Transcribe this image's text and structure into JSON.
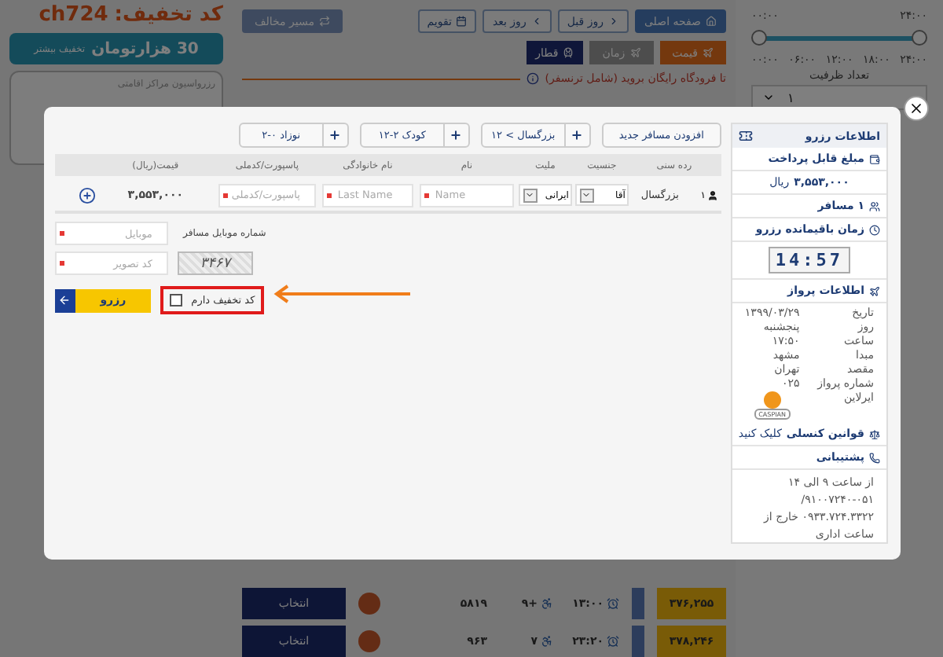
{
  "background": {
    "promo": {
      "code_label": "کد تخفیف:",
      "code": "ch724",
      "amount": "30 هزارتومان",
      "amount_note": "تخفیف بیشتر",
      "banner": "رزرواسیون مراکز اقامتی"
    },
    "nav_buttons": [
      {
        "label": "صفحه اصلی",
        "kind": "home"
      },
      {
        "label": "روز قبل",
        "kind": "prev"
      },
      {
        "label": "روز بعد",
        "kind": "next"
      },
      {
        "label": "تقویم",
        "kind": "calendar"
      }
    ],
    "reverse_button": "مسیر مخالف",
    "sort_tabs": [
      {
        "label": "قیمت",
        "selected": true
      },
      {
        "label": "زمان",
        "selected": false
      }
    ],
    "train_button": "قطار",
    "transfer_note": "تا فرودگاه رایگان بروید (شامل ترنسفر)",
    "time_filter": {
      "from": "۰۰:۰۰",
      "to": "۲۴:۰۰",
      "level": 1,
      "ticks": [
        "۲۴:۰۰",
        "۱۸:۰۰",
        "۱۲:۰۰",
        "۰۶:۰۰",
        "۰۰:۰۰"
      ]
    },
    "capacity": {
      "label": "تعداد ظرفیت",
      "value": "۱"
    },
    "flights": [
      {
        "price": "۳۷۶,۲۵۵",
        "time": "۱۳:۰۰",
        "seats": "+۹",
        "number": "۵۸۱۹",
        "action": "انتخاب"
      },
      {
        "price": "۳۷۸,۲۴۶",
        "time": "۲۳:۲۰",
        "seats": "۷",
        "number": "۹۶۳",
        "action": "انتخاب"
      }
    ]
  },
  "modal": {
    "add_passenger": "افزودن مسافر جدید",
    "counters": [
      {
        "label": "بزرگسال > ۱۲"
      },
      {
        "label": "کودک ۲-۱۲"
      },
      {
        "label": "نوزاد ۰-۲"
      }
    ],
    "columns": [
      "رده سنی",
      "جنسیت",
      "ملیت",
      "نام",
      "نام خانوادگی",
      "پاسپورت/کدملی",
      "قیمت(ریال)"
    ],
    "passengers": [
      {
        "index": "۱",
        "age_group": "بزرگسال",
        "gender": "آقا",
        "nationality": "ایرانی",
        "name_placeholder": "Name",
        "lastname_placeholder": "Last Name",
        "passport_placeholder": "پاسپورت/کدملی",
        "price": "۳,۵۵۳,۰۰۰"
      }
    ],
    "mobile": {
      "label": "شماره موبایل مسافر",
      "placeholder": "موبایل"
    },
    "captcha": {
      "image_text": "۳۴۶۷",
      "placeholder": "کد تصویر"
    },
    "discount": {
      "label": "کد تخفیف دارم",
      "checked": false
    },
    "submit": "رزرو",
    "sidebar": {
      "title": "اطلاعات رزرو",
      "amount_label": "مبلغ قابل پرداخت",
      "amount": "۳,۵۵۳,۰۰۰",
      "currency": "ریال",
      "passengers": "۱ مسافر",
      "timer_label": "زمان باقیمانده رزرو",
      "timer": "14:57",
      "flight_title": "اطلاعات پرواز",
      "flight_info": [
        {
          "label": "تاریخ",
          "value": "۱۳۹۹/۰۳/۲۹"
        },
        {
          "label": "روز",
          "value": "پنجشنبه"
        },
        {
          "label": "ساعت",
          "value": "۱۷:۵۰"
        },
        {
          "label": "مبدا",
          "value": "مشهد"
        },
        {
          "label": "مقصد",
          "value": "تهران"
        },
        {
          "label": "شماره پرواز",
          "value": "۰۲۵"
        }
      ],
      "airline_label": "ایرلاین",
      "airline_logo_text": "CASPIAN",
      "rules_label": "قوانین کنسلی",
      "rules_link": "کلیک کنید",
      "support_title": "پشتیبانی",
      "support_text": "از ساعت ۹ الی ۱۴ ۰۵۱-۹۱۰۰۷۲۴۰/ ۰۹۳۳.۷۲۴.۳۳۲۲ خارج از ساعت اداری"
    }
  }
}
